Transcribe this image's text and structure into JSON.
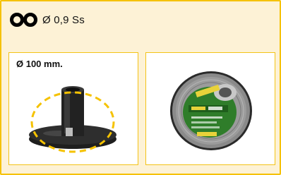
{
  "spec": {
    "icon": "double-circle-icon",
    "text": "Ø 0,9 Ss"
  },
  "cards": [
    {
      "label": "Ø 100 mm.",
      "image": "spool-holder-image"
    },
    {
      "label": "",
      "image": "wire-spool-image"
    }
  ],
  "colors": {
    "panel_bg": "#fdf2d6",
    "panel_border": "#f5c200",
    "highlight": "#f5c200"
  }
}
